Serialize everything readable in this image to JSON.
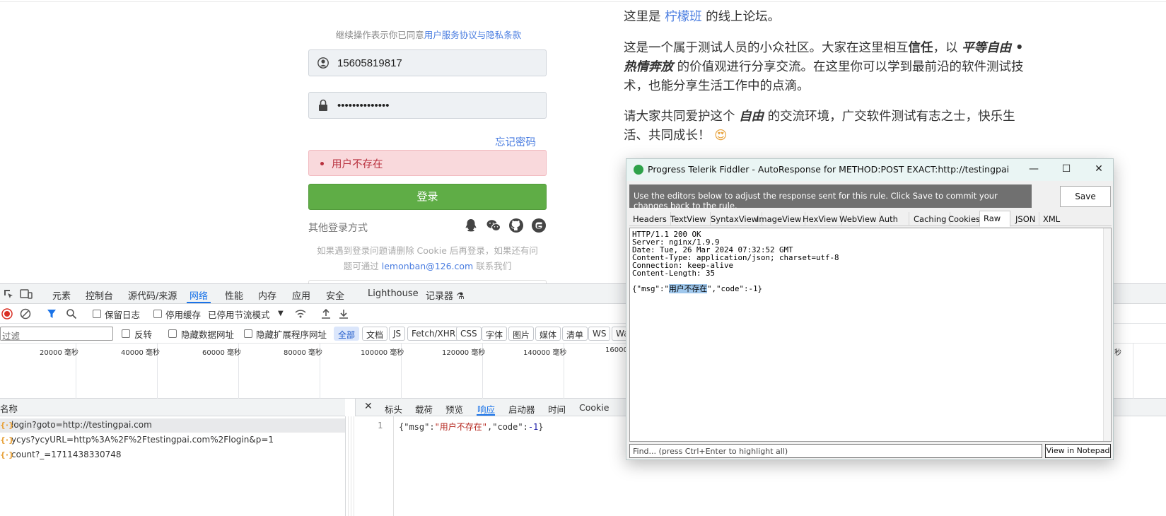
{
  "login": {
    "agree_prefix": "继续操作表示你已同意",
    "agree_link": "用户服务协议与隐私条款",
    "phone_value": "15605819817",
    "password_value": "••••••••••••••",
    "forgot": "忘记密码",
    "error": "用户不存在",
    "submit": "登录",
    "other_login": "其他登录方式",
    "help_1": "如果遇到登录问题请删除 Cookie 后再登录，如果还有问",
    "help_2a": "题可通过 ",
    "help_email": "lemonban@126.com",
    "help_2b": " 联系我们"
  },
  "intro": {
    "p1_a": "这里是 ",
    "brand": "柠檬班",
    "p1_b": " 的线上论坛。",
    "p2_a": "这是一个属于测试人员的小众社区。大家在这里相互",
    "p2_trust": "信任",
    "p2_b": "，以 ",
    "p2_free": "平等自由 •",
    "p2_free2": "热情奔放",
    "p2_c": " 的价值观进行分享交流。在这里你可以学到最前沿的软件测试技",
    "p2_d": "术，也能分享生活工作中的点滴。",
    "p3_a": "请大家共同爱护这个 ",
    "p3_free": "自由",
    "p3_b": " 的交流环境，广交软件测试有志之士，快乐生",
    "p3_c": "活、共同成长！",
    "emoji": "😍"
  },
  "devtools": {
    "tabs": [
      "元素",
      "控制台",
      "源代码/来源",
      "网络",
      "性能",
      "内存",
      "应用",
      "安全",
      "Lighthouse",
      "记录器 ⚗"
    ],
    "active_tab": "网络",
    "preserve_log": "保留日志",
    "disable_cache": "停用缓存",
    "throttle": "已停用节流模式",
    "filter_placeholder": "过滤",
    "invert": "反转",
    "hide_data_urls": "隐藏数据网址",
    "hide_ext_urls": "隐藏扩展程序网址",
    "chips": [
      "全部",
      "文档",
      "JS",
      "Fetch/XHR",
      "CSS",
      "字体",
      "图片",
      "媒体",
      "清单",
      "WS",
      "Wa"
    ],
    "ticks": [
      "20000 毫秒",
      "40000 毫秒",
      "60000 毫秒",
      "80000 毫秒",
      "100000 毫秒",
      "120000 毫秒",
      "140000 毫秒",
      "16000",
      "秒"
    ],
    "col_name": "名称",
    "requests": [
      "login?goto=http://testingpai.com",
      "ycys?ycyURL=http%3A%2F%2Ftestingpai.com%2Flogin&p=1",
      "count?_=1711438330748"
    ],
    "detail_tabs": [
      "标头",
      "载荷",
      "预览",
      "响应",
      "启动器",
      "时间",
      "Cookie"
    ],
    "active_detail_tab": "响应",
    "line_no": "1",
    "resp_a": "{\"msg\":",
    "resp_msg": "\"用户不存在\"",
    "resp_b": ",\"code\":",
    "resp_code": "-1",
    "resp_c": "}"
  },
  "fiddler": {
    "title": "Progress Telerik Fiddler - AutoResponse for METHOD:POST EXACT:http://testingpai.com/login?g...",
    "banner": "Use the editors below to adjust the response sent for this rule. Click Save to commit your changes back to the rule.",
    "save": "Save",
    "tabs": [
      "Headers",
      "TextView",
      "SyntaxView",
      "ImageView",
      "HexView",
      "WebView",
      "Auth",
      "Caching",
      "Cookies",
      "Raw",
      "JSON",
      "XML"
    ],
    "active_tab": "Raw",
    "raw_lines": [
      "HTTP/1.1 200 OK",
      "Server: nginx/1.9.9",
      "Date: Tue, 26 Mar 2024 07:32:52 GMT",
      "Content-Type: application/json; charset=utf-8",
      "Connection: keep-alive",
      "Content-Length: 35"
    ],
    "body_a": "{\"msg\":\"",
    "body_hl": "用户不存在",
    "body_b": "\",\"code\":-1}",
    "find_placeholder": "Find... (press Ctrl+Enter to highlight all)",
    "view_notepad": "View in Notepad"
  },
  "colors": {
    "accent": "#1a73e8",
    "login_green": "#5fad46",
    "error_bg": "#f9d9dc",
    "link": "#4a7de0"
  }
}
